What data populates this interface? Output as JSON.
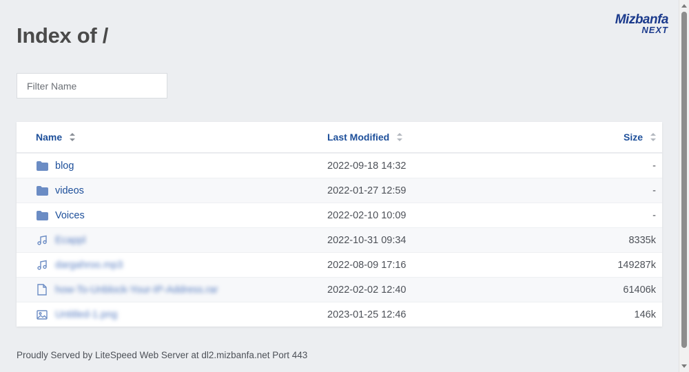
{
  "header": {
    "title": "Index of /",
    "logo_main": "Mizbanfa",
    "logo_sub": "NEXT"
  },
  "filter": {
    "placeholder": "Filter Name",
    "value": ""
  },
  "table": {
    "columns": {
      "name": "Name",
      "modified": "Last Modified",
      "size": "Size"
    },
    "rows": [
      {
        "icon": "folder-icon",
        "name": "blog",
        "modified": "2022-09-18 14:32",
        "size": "-"
      },
      {
        "icon": "folder-icon",
        "name": "videos",
        "modified": "2022-01-27 12:59",
        "size": "-"
      },
      {
        "icon": "folder-icon",
        "name": "Voices",
        "modified": "2022-02-10 10:09",
        "size": "-"
      },
      {
        "icon": "music-file-icon",
        "name": "",
        "modified": "2022-10-31 09:34",
        "size": "8335k"
      },
      {
        "icon": "music-file-icon",
        "name": "",
        "modified": "2022-08-09 17:16",
        "size": "149287k"
      },
      {
        "icon": "document-file-icon",
        "name": "",
        "modified": "2022-02-02 12:40",
        "size": "61406k"
      },
      {
        "icon": "image-file-icon",
        "name": "",
        "modified": "2023-01-25 12:46",
        "size": "146k"
      }
    ]
  },
  "footer": {
    "text": "Proudly Served by LiteSpeed Web Server at dl2.mizbanfa.net Port 443"
  },
  "colors": {
    "background": "#eceef1",
    "link": "#1d4f9a",
    "icon": "#6b8cc4",
    "brand": "#1b3a8c"
  }
}
